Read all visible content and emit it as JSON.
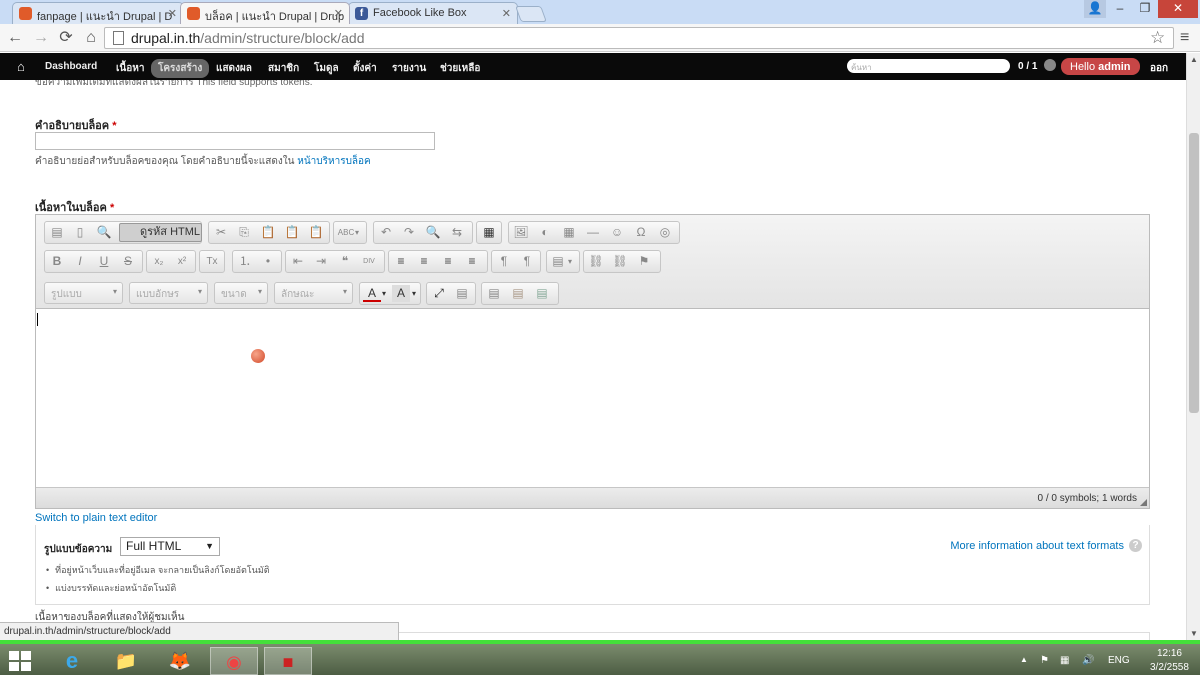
{
  "browser": {
    "tabs": [
      {
        "title": "fanpage | แนะนำ Drupal | D",
        "icon": "drupal-favicon"
      },
      {
        "title": "บล็อค | แนะนำ Drupal | Drup",
        "icon": "drupal-favicon",
        "active": true
      },
      {
        "title": "Facebook Like Box",
        "icon": "facebook-favicon"
      }
    ],
    "tab_close": "✕",
    "facebook_letter": "f",
    "url_host": "drupal.in.th",
    "url_path": "/admin/structure/block/add",
    "window_controls": {
      "user": "👤",
      "minimize": "–",
      "maximize": "❐",
      "close": "✕"
    },
    "nav": {
      "back": "←",
      "forward": "→",
      "reload": "⟳",
      "home": "⌂",
      "star": "☆",
      "menu": "≡"
    }
  },
  "toolbar": {
    "home": "⌂",
    "items": [
      "Dashboard",
      "เนื้อหา",
      "โครงสร้าง",
      "แสดงผล",
      "สมาชิก",
      "โมดูล",
      "ตั้งค่า",
      "รายงาน",
      "ช่วยเหลือ"
    ],
    "active_index": 2,
    "search_placeholder": "ค้นหา",
    "counter": "0 / 1",
    "hello_prefix": "Hello ",
    "hello_user": "admin",
    "logout": "ออก"
  },
  "form": {
    "cut_text": "ข้อความเพิ่มเติมที่แสดงผลในรายการ This field supports tokens.",
    "block_description": {
      "label": "คำอธิบายบล็อค",
      "required": "*",
      "value": "",
      "help": "คำอธิบายย่อสำหรับบล็อคของคุณ โดยคำอธิบายนี้จะแสดงใน ",
      "help_link": "หน้าบริหารบล็อค"
    },
    "block_body": {
      "label": "เนื้อหาในบล็อค",
      "required": "*"
    }
  },
  "editor": {
    "source_button": "ดูรหัส HTML",
    "combos": [
      "รูปแบบ",
      "แบบอักษร",
      "ขนาด",
      "ลักษณะ"
    ],
    "toolbar_row1_g1": [
      "▤",
      "▯",
      "🔍"
    ],
    "toolbar_row1_g2": [
      "✂",
      "⎘",
      "📋",
      "📋",
      "📋"
    ],
    "toolbar_row1_g3": [
      "ABC"
    ],
    "toolbar_row1_g4": [
      "↶",
      "↷",
      "🔍",
      "⇆"
    ],
    "toolbar_row1_g5": [
      "▦"
    ],
    "toolbar_row1_g6": [
      "🖼",
      "◐",
      "▦",
      "―",
      "☺",
      "Ω",
      "◎"
    ],
    "toolbar_row2_g1": [
      "B",
      "I",
      "U",
      "S"
    ],
    "toolbar_row2_g2": [
      "x₂",
      "x²"
    ],
    "toolbar_row2_g3": [
      "Tx"
    ],
    "toolbar_row2_g4": [
      "⒈",
      "•"
    ],
    "toolbar_row2_g5": [
      "⇤",
      "⇥",
      "❝",
      "DIV"
    ],
    "toolbar_row2_g6": [
      "≡",
      "≡",
      "≡",
      "≡"
    ],
    "toolbar_row2_g7": [
      "¶",
      "¶"
    ],
    "toolbar_row2_g8": [
      "▤"
    ],
    "toolbar_row2_g9": [
      "⛓",
      "⛓",
      "⚑"
    ],
    "toolbar_row3_colors": [
      "A",
      "A"
    ],
    "toolbar_row3_g2": [
      "⤢",
      "▤"
    ],
    "toolbar_row3_g3": [
      "▤",
      "▤",
      "▤"
    ],
    "dropdown_arrow": "▾",
    "word_count": "0 / 0 symbols; 1 words"
  },
  "format": {
    "switch_link": "Switch to plain text editor",
    "label": "รูปแบบข้อความ",
    "selected": "Full HTML",
    "select_arrow": "▼",
    "more_info": "More information about text formats",
    "help_icon": "?",
    "tips": [
      "ที่อยู่หน้าเว็บและที่อยู่อีเมล จะกลายเป็นลิงก์โดยอัตโนมัติ",
      "แบ่งบรรทัดและย่อหน้าอัตโนมัติ"
    ]
  },
  "block_body_help": "เนื้อหาของบล็อคที่แสดงให้ผู้ชมเห็น",
  "scrollbar": {
    "up": "▲",
    "down": "▼"
  },
  "status_bar": "drupal.in.th/admin/structure/block/add",
  "taskbar": {
    "apps": [
      "internet-explorer",
      "file-explorer",
      "firefox",
      "chrome",
      "recorder"
    ],
    "app_glyphs": {
      "ie": "e",
      "explorer": "📁",
      "firefox": "🦊",
      "chrome": "◉",
      "recorder": "■"
    },
    "tray": {
      "up": "▲",
      "flag": "⚑",
      "network": "▦",
      "volume": "🔊"
    },
    "language": "ENG",
    "time": "12:16",
    "date": "3/2/2558"
  }
}
